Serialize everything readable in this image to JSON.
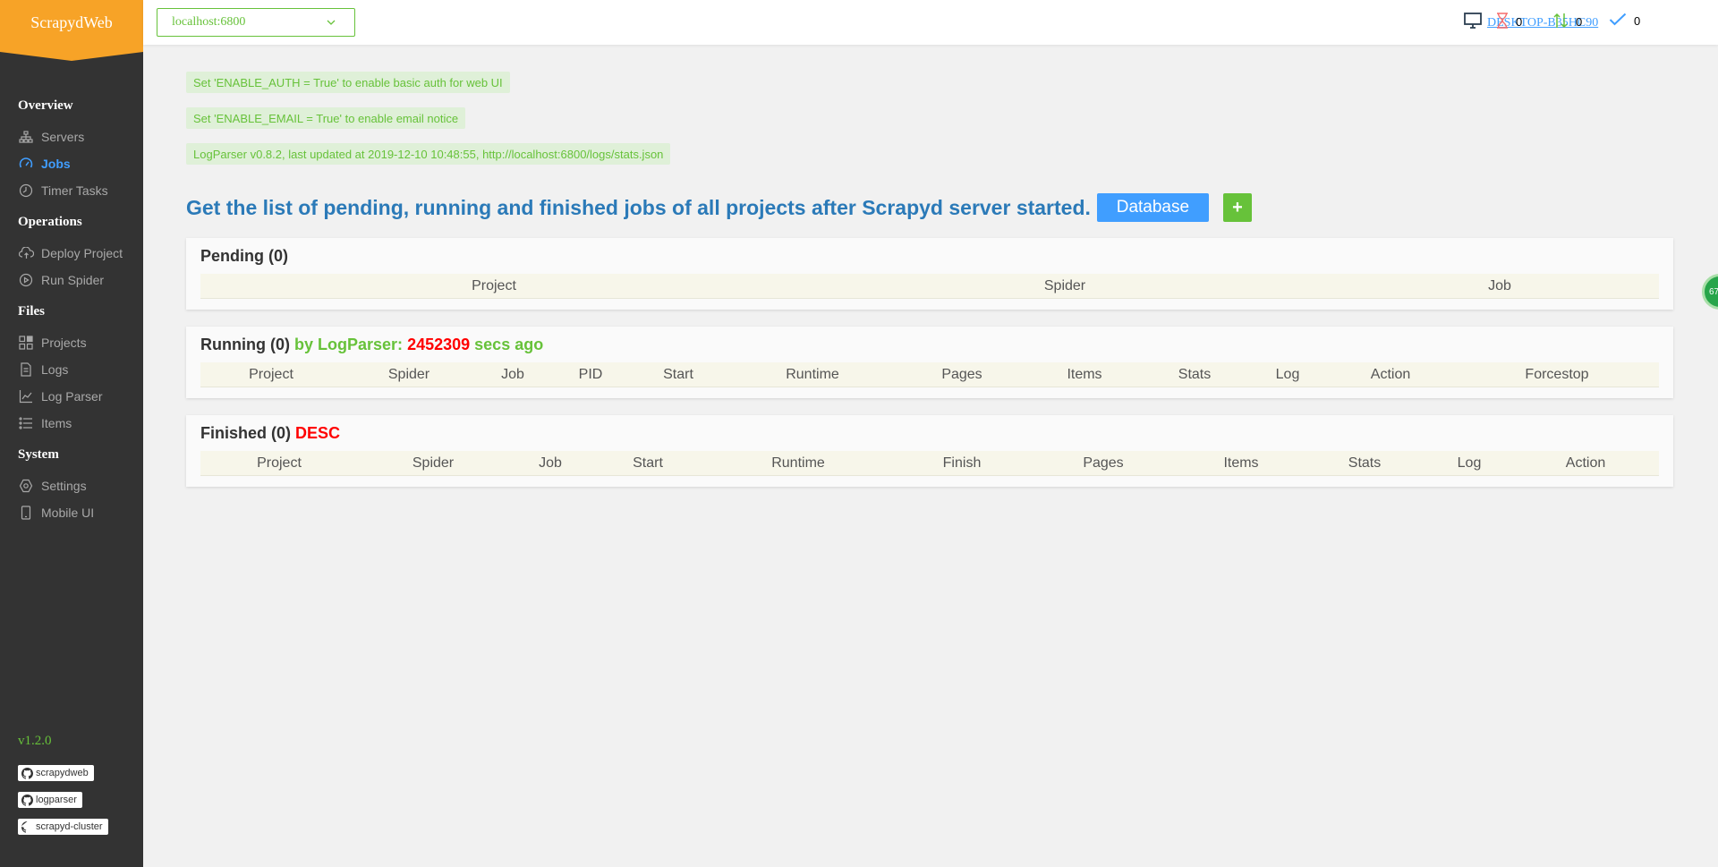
{
  "app": {
    "logo": "ScrapydWeb",
    "version": "v1.2.0",
    "github_links": [
      "scrapydweb",
      "logparser",
      "scrapyd-cluster"
    ]
  },
  "sidebar": {
    "groups": [
      {
        "title": "Overview",
        "items": [
          {
            "label": "Servers",
            "icon": "sitemap-icon",
            "active": false
          },
          {
            "label": "Jobs",
            "icon": "dashboard-icon",
            "active": true
          },
          {
            "label": "Timer Tasks",
            "icon": "timer-icon",
            "active": false
          }
        ]
      },
      {
        "title": "Operations",
        "items": [
          {
            "label": "Deploy Project",
            "icon": "upload-cloud-icon",
            "active": false
          },
          {
            "label": "Run Spider",
            "icon": "play-icon",
            "active": false
          }
        ]
      },
      {
        "title": "Files",
        "items": [
          {
            "label": "Projects",
            "icon": "grid-icon",
            "active": false
          },
          {
            "label": "Logs",
            "icon": "document-icon",
            "active": false
          },
          {
            "label": "Log Parser",
            "icon": "chart-icon",
            "active": false
          },
          {
            "label": "Items",
            "icon": "list-icon",
            "active": false
          }
        ]
      },
      {
        "title": "System",
        "items": [
          {
            "label": "Settings",
            "icon": "gear-icon",
            "active": false
          },
          {
            "label": "Mobile UI",
            "icon": "mobile-icon",
            "active": false
          }
        ]
      }
    ]
  },
  "header": {
    "node_selected": "localhost:6800",
    "hostname": "DESKTOP-B35HC90",
    "pending_count": "0",
    "running_count": "0",
    "finished_count": "0"
  },
  "notices": [
    "Set 'ENABLE_AUTH = True' to enable basic auth for web UI",
    "Set 'ENABLE_EMAIL = True' to enable email notice",
    "LogParser v0.8.2, last updated at 2019-12-10 10:48:55, http://localhost:6800/logs/stats.json"
  ],
  "page": {
    "title": "Get the list of pending, running and finished jobs of all projects after Scrapyd server started.",
    "database_button": "Database",
    "add_button": "+"
  },
  "pending": {
    "title": "Pending (0)",
    "columns": [
      "Project",
      "Spider",
      "Job"
    ]
  },
  "running": {
    "title": "Running (0)",
    "by_logparser": "by LogParser:",
    "secs": "2452309",
    "secs_ago": "secs ago",
    "columns": [
      "Project",
      "Spider",
      "Job",
      "PID",
      "Start",
      "Runtime",
      "Pages",
      "Items",
      "Stats",
      "Log",
      "Action",
      "Forcestop"
    ]
  },
  "finished": {
    "title": "Finished (0)",
    "order": "DESC",
    "columns": [
      "Project",
      "Spider",
      "Job",
      "Start",
      "Runtime",
      "Finish",
      "Pages",
      "Items",
      "Stats",
      "Log",
      "Action"
    ]
  },
  "float_badge": "67"
}
